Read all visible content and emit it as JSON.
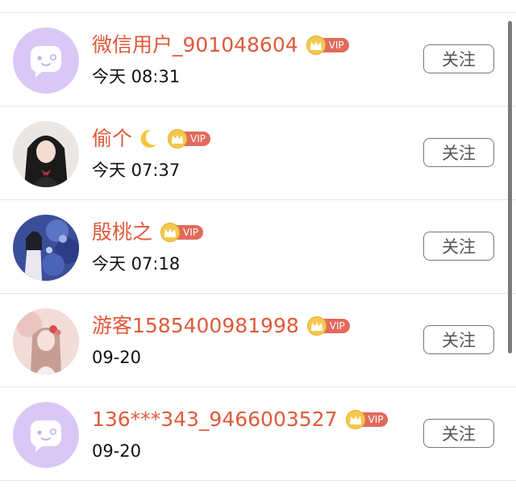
{
  "colors": {
    "name": "#e05a3a",
    "vip_tag": "#e26a5c",
    "vip_crown": "#f2c94c",
    "default_avatar_bg": "#d9c8f5",
    "divider": "#e6e6e6"
  },
  "users": [
    {
      "name": "微信用户_901048604",
      "badge": "VIP",
      "time": "今天 08:31",
      "follow_label": "关注",
      "avatar": "default-avatar-icon",
      "emoji": false
    },
    {
      "name": "偷个",
      "badge": "VIP",
      "time": "今天 07:37",
      "follow_label": "关注",
      "avatar": "photo-avatar-girl",
      "emoji": true
    },
    {
      "name": "殷桃之",
      "badge": "VIP",
      "time": "今天 07:18",
      "follow_label": "关注",
      "avatar": "photo-avatar-flowers",
      "emoji": false
    },
    {
      "name": "游客1585400981998",
      "badge": "VIP",
      "time": "09-20",
      "follow_label": "关注",
      "avatar": "photo-avatar-pink",
      "emoji": false
    },
    {
      "name": "136***343_9466003527",
      "badge": "VIP",
      "time": "09-20",
      "follow_label": "关注",
      "avatar": "default-avatar-icon",
      "emoji": false
    }
  ]
}
